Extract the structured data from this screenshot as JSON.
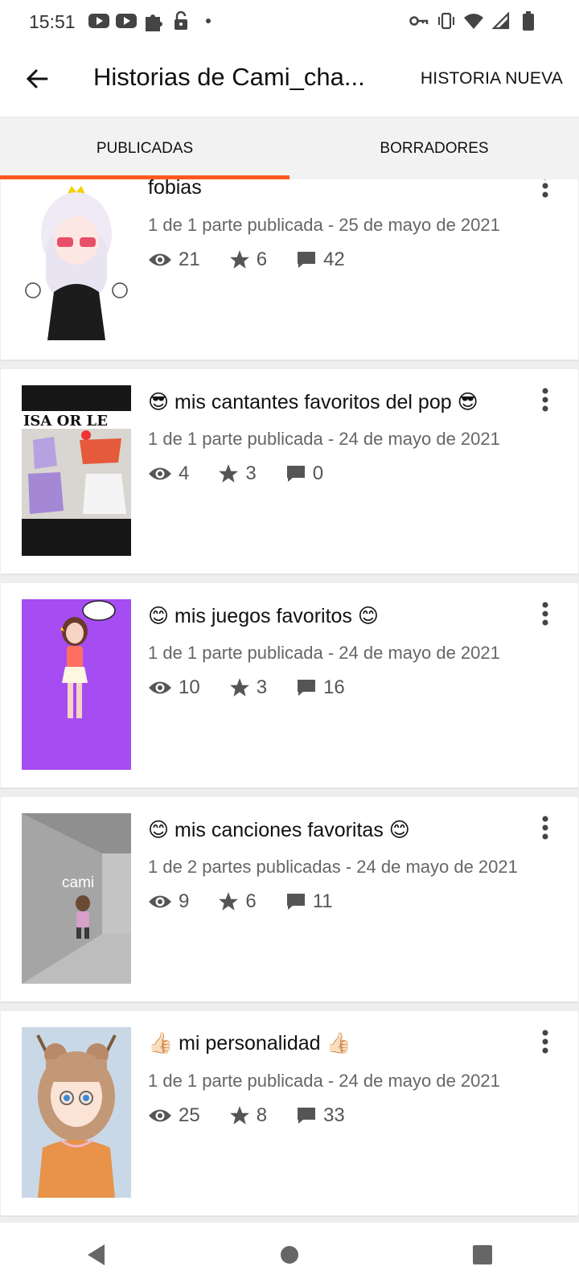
{
  "status_bar": {
    "time": "15:51",
    "left_icons": [
      "youtube-icon",
      "youtube-icon",
      "puzzle-icon",
      "lock-open-icon",
      "dot-icon"
    ],
    "right_icons": [
      "key-icon",
      "vibrate-icon",
      "wifi-icon",
      "signal-icon",
      "battery-icon"
    ]
  },
  "app_bar": {
    "title": "Historias de Cami_cha...",
    "new_story_label": "HISTORIA NUEVA"
  },
  "tabs": [
    {
      "label": "PUBLICADAS",
      "active": true
    },
    {
      "label": "BORRADORES",
      "active": false
    }
  ],
  "accent_color": "#ff5a1f",
  "stories": [
    {
      "title": "fobias",
      "meta": "1 de 1 parte publicada - 25 de mayo de 2021",
      "views": "21",
      "votes": "6",
      "comments": "42",
      "cover": "white-hair-avatar"
    },
    {
      "title": "😎 mis cantantes favoritos del pop 😎",
      "meta": "1 de 1 parte publicada - 24 de mayo de 2021",
      "views": "4",
      "votes": "3",
      "comments": "0",
      "cover": "clothes-photo",
      "cover_text": "ISA OR LE"
    },
    {
      "title": "😊 mis juegos favoritos 😊",
      "meta": "1 de 1 parte publicada - 24 de mayo de 2021",
      "views": "10",
      "votes": "3",
      "comments": "16",
      "cover": "purple-avatar"
    },
    {
      "title": "😊 mis canciones favoritas 😊",
      "meta": "1 de 2 partes publicadas - 24 de mayo de 2021",
      "views": "9",
      "votes": "6",
      "comments": "11",
      "cover": "grey-hallway",
      "cover_text": "cami"
    },
    {
      "title": "👍🏻 mi personalidad 👍🏻",
      "meta": "1 de 1 parte publicada - 24 de mayo de 2021",
      "views": "25",
      "votes": "8",
      "comments": "33",
      "cover": "anime-girl"
    }
  ]
}
